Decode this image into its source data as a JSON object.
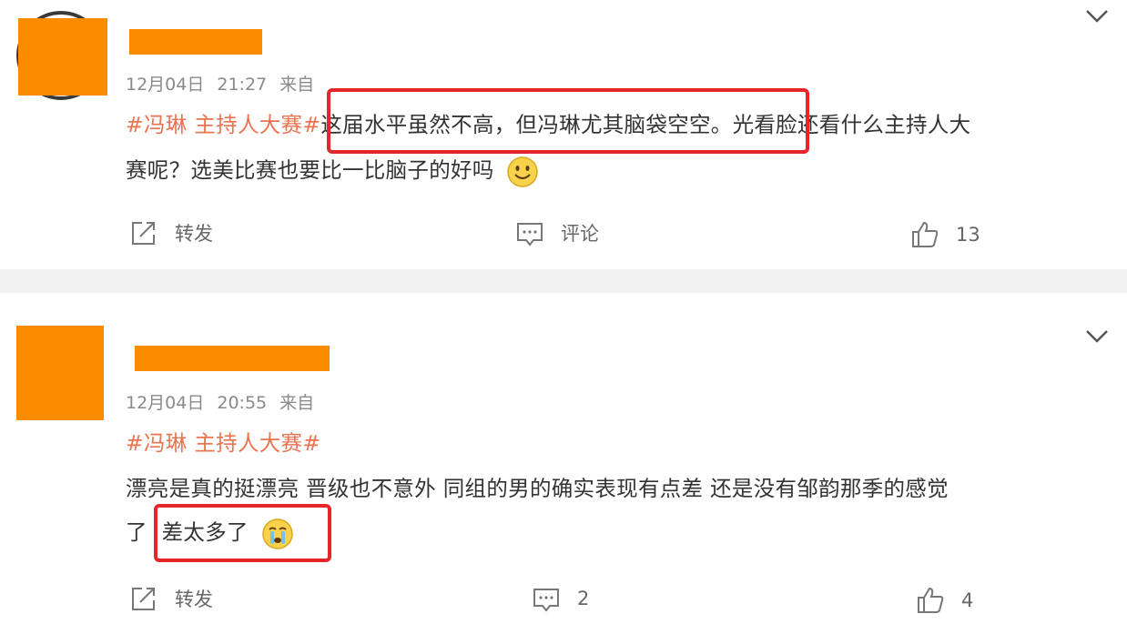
{
  "posts": [
    {
      "name_visible": "",
      "date": "12月04日",
      "time": "21:27",
      "source": "来自",
      "hashtag": "#冯琳 主持人大赛#",
      "line1_highlight": "这届水平虽然不高，但冯琳尤其脑袋空空",
      "line1_rest": "。光看脸还看什么主持人大",
      "line2": "赛呢？选美比赛也要比一比脑子的好吗",
      "emoji": "smile-emoji",
      "actions": {
        "repost": "转发",
        "comment": "评论",
        "like": "13"
      }
    },
    {
      "name_visible": "",
      "date": "12月04日",
      "time": "20:55",
      "source": "来自",
      "hashtag": "#冯琳 主持人大赛#",
      "line1": "漂亮是真的挺漂亮 晋级也不意外 同组的男的确实表现有点差 还是没有邹韵那季的感觉",
      "line2_pre": "了",
      "line2_highlight": "差太多了",
      "emoji": "crying-emoji",
      "actions": {
        "repost": "转发",
        "comment": "2",
        "like": "4"
      }
    }
  ],
  "colors": {
    "hashtag": "#eb7350",
    "highlight": "#e5252a",
    "redaction": "#fb8c00"
  }
}
